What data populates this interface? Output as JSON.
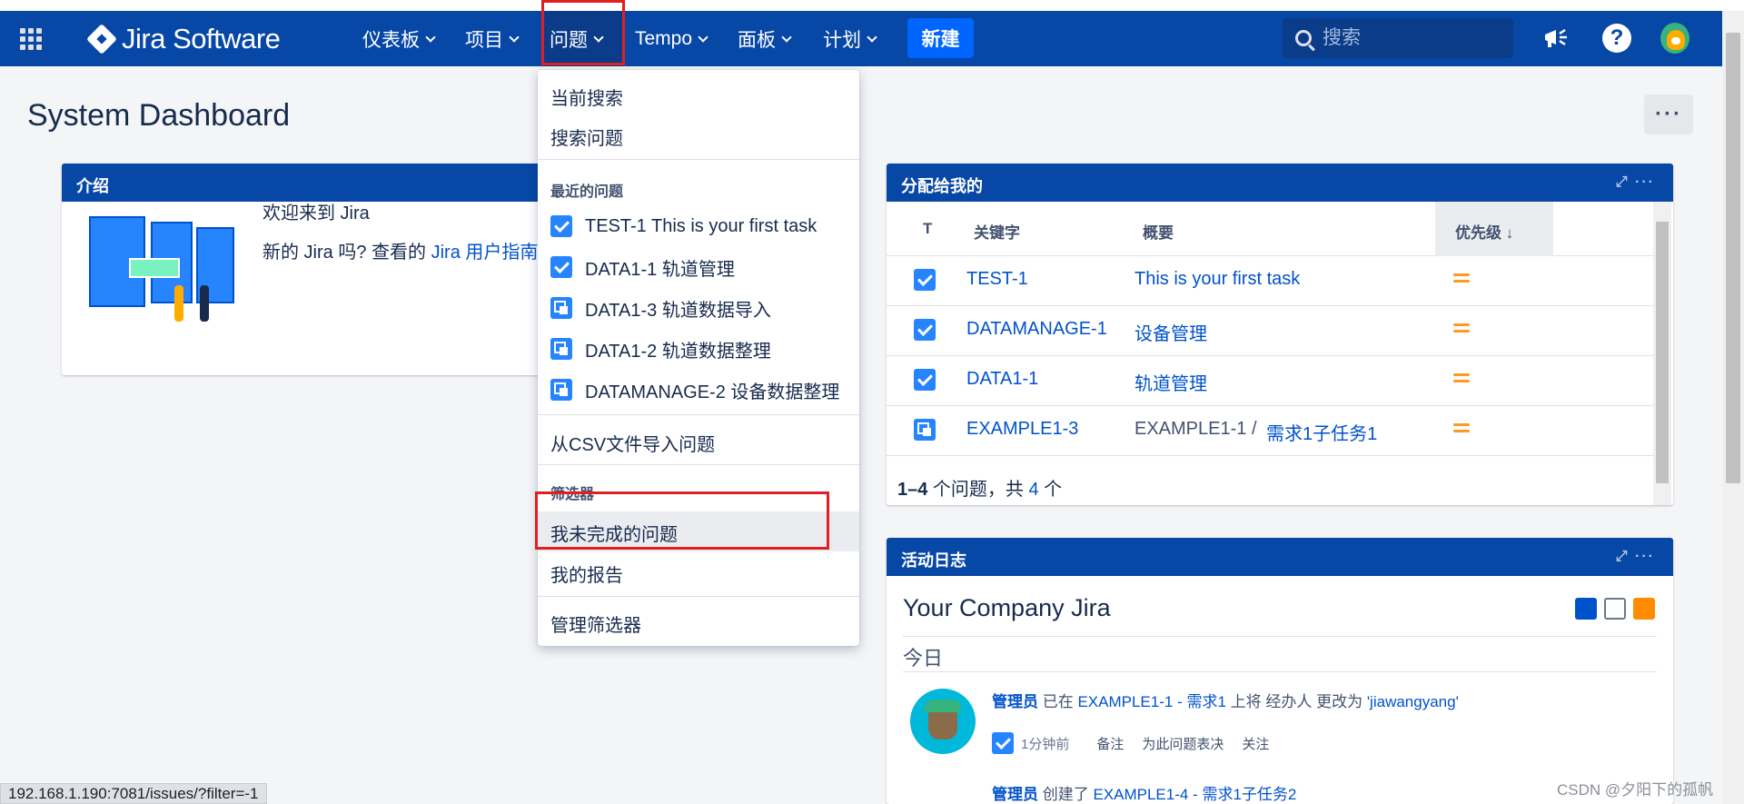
{
  "app": {
    "name": "Jira Software"
  },
  "nav": {
    "items": [
      "仪表板",
      "项目",
      "问题",
      "Tempo",
      "面板",
      "计划"
    ],
    "create_label": "新建",
    "search_placeholder": "搜索"
  },
  "page": {
    "title": "System Dashboard",
    "more_label": "···"
  },
  "intro_gadget": {
    "title": "介绍",
    "welcome": "欢迎来到 Jira",
    "desc_prefix": "新的 Jira 吗? 查看的",
    "desc_link": " Jira 用户指南"
  },
  "assigned_gadget": {
    "title": "分配给我的",
    "columns": {
      "type": "T",
      "key": "关键字",
      "summary": "概要",
      "priority": "优先级"
    },
    "rows": [
      {
        "type": "task",
        "key": "TEST-1",
        "parent": "",
        "summary": "This is your first task"
      },
      {
        "type": "task",
        "key": "DATAMANAGE-1",
        "parent": "",
        "summary": "设备管理"
      },
      {
        "type": "task",
        "key": "DATA1-1",
        "parent": "",
        "summary": "轨道管理"
      },
      {
        "type": "subtask",
        "key": "EXAMPLE1-3",
        "parent": "EXAMPLE1-1 /",
        "summary": "需求1子任务1"
      }
    ],
    "footer": {
      "range": "1–4",
      "text_mid": " 个问题，共 ",
      "total": "4",
      "text_end": " 个"
    }
  },
  "activity_gadget": {
    "title": "活动日志",
    "stream_title": "Your Company Jira",
    "day": "今日",
    "entry1": {
      "user": "管理员",
      "t1": " 已在 ",
      "issue": "EXAMPLE1-1 - 需求1",
      "t2": " 上将 经办人 更改为 ",
      "value": "'jiawangyang'",
      "time": "1分钟前",
      "actions": [
        "备注",
        "为此问题表决",
        "关注"
      ]
    },
    "entry2": {
      "user": "管理员",
      "t1": " 创建了 ",
      "issue": "EXAMPLE1-4 - 需求1子任务2"
    }
  },
  "issues_menu": {
    "top_items": [
      "当前搜索",
      "搜索问题"
    ],
    "recent_heading": "最近的问题",
    "recent": [
      {
        "icon": "task",
        "label": "TEST-1 This is your first task"
      },
      {
        "icon": "task",
        "label": "DATA1-1 轨道管理"
      },
      {
        "icon": "subtask",
        "label": "DATA1-3 轨道数据导入"
      },
      {
        "icon": "subtask",
        "label": "DATA1-2 轨道数据整理"
      },
      {
        "icon": "subtask",
        "label": "DATAMANAGE-2 设备数据整理"
      }
    ],
    "import_csv": "从CSV文件导入问题",
    "filters_heading": "筛选器",
    "filters": [
      "我未完成的问题",
      "我的报告"
    ],
    "manage_filters": "管理筛选器"
  },
  "status_url": "192.168.1.190:7081/issues/?filter=-1",
  "watermark": "CSDN @夕阳下的孤帆",
  "colors": {
    "nav": "#0747a6",
    "link": "#0052cc",
    "create": "#0065ff",
    "highlight": "#e02020",
    "priority_medium": "#ff991f"
  }
}
